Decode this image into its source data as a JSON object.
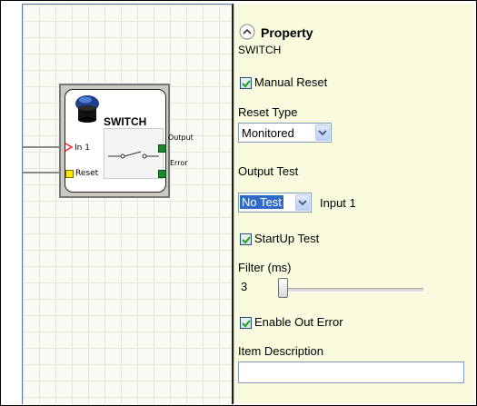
{
  "canvas": {
    "block": {
      "title": "SWITCH",
      "inputs": [
        "In 1",
        "Reset"
      ],
      "outputs": [
        "Output",
        "Error"
      ]
    }
  },
  "panel": {
    "header": "Property",
    "subtitle": "SWITCH",
    "manual_reset": {
      "label": "Manual Reset",
      "checked": true
    },
    "reset_type": {
      "label": "Reset Type",
      "value": "Monitored"
    },
    "output_test": {
      "label": "Output Test",
      "value": "No Test",
      "extra": "Input 1"
    },
    "startup_test": {
      "label": "StartUp Test",
      "checked": true
    },
    "filter": {
      "label": "Filter (ms)",
      "value": "3"
    },
    "enable_out_error": {
      "label": "Enable Out Error",
      "checked": true
    },
    "item_description": {
      "label": "Item Description",
      "value": ""
    }
  },
  "colors": {
    "panel_bg": "#fafadf",
    "output_pin": "#1a8a2a",
    "reset_pin": "#ffe800",
    "input_marker": "#ff2020",
    "selection": "#316ac5"
  }
}
